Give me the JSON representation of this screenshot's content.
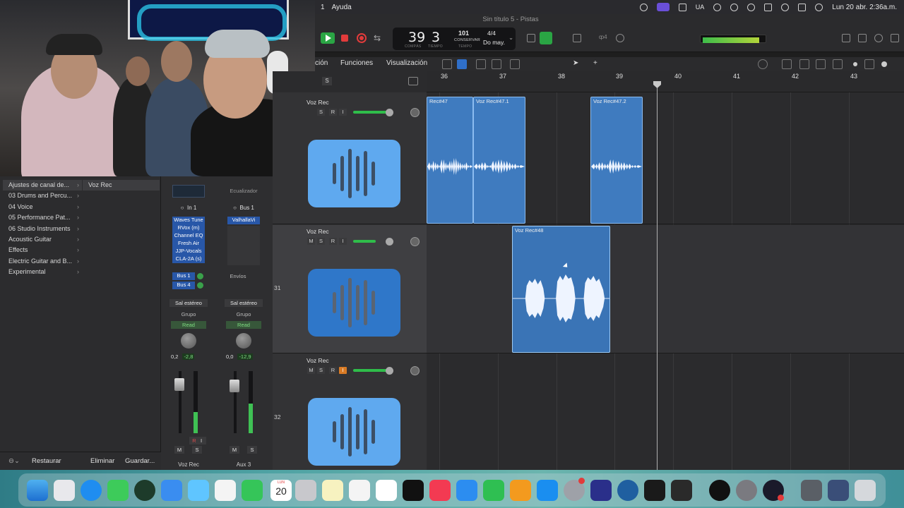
{
  "menubar": {
    "menu_num": "1",
    "menu_help": "Ayuda",
    "status_lang": "UA",
    "clock": "Lun 20 abr.  2:36a.m."
  },
  "window": {
    "title": "Sin título 5 - Pistas"
  },
  "transport": {
    "bar": "39",
    "beat": "3",
    "bar_label": "COMPÁS",
    "beat_label": "TIEMPO",
    "tempo": "101",
    "tempo_mode": "CONSERVAR",
    "tempo_label": "TEMPO",
    "time_sig": "4/4",
    "key": "Do may.",
    "count_in": "ȹ4"
  },
  "toolbar": {
    "menu_edit": "ción",
    "menu_functions": "Funciones",
    "menu_view": "Visualización"
  },
  "ruler": {
    "bars": [
      "36",
      "37",
      "38",
      "39",
      "40",
      "41",
      "42",
      "43"
    ]
  },
  "library": {
    "items": [
      "Ajustes de canal de...",
      "03 Drums and Percu...",
      "04 Voice",
      "05 Performance Pat...",
      "06 Studio Instruments",
      "Acoustic Guitar",
      "Effects",
      "Electric Guitar and B...",
      "Experimental"
    ],
    "selected_sub": "Voz Rec",
    "footer_restore": "Restaurar",
    "footer_delete": "Eliminar",
    "footer_save": "Guardar..."
  },
  "inspector": {
    "strip1": {
      "input": "In 1",
      "plugins": [
        "Waves Tune",
        "RVox (m)",
        "Channel EQ",
        "Fresh Air",
        "JJP-Vocals",
        "CLA-2A (s)"
      ],
      "sends": [
        "Bus 1",
        "Bus 4"
      ],
      "output": "Sal estéreo",
      "group": "Grupo",
      "automation": "Read",
      "pan_value": "0,2",
      "gain_value": "-2,8",
      "name": "Voz Rec",
      "mute": "M",
      "solo": "S",
      "rec": "R",
      "input_mon": "I"
    },
    "strip2": {
      "eq_label": "Ecualizador",
      "input": "Bus 1",
      "plugins": [
        "ValhallaVi"
      ],
      "sends_label": "Envíos",
      "output": "Sal estéreo",
      "group": "Grupo",
      "automation": "Read",
      "pan_value": "0,0",
      "gain_value": "-12,9",
      "name": "Aux 3",
      "mute": "M",
      "solo": "S"
    }
  },
  "tracks": [
    {
      "number": "",
      "name": "Voz Rec",
      "buttons": [
        "S",
        "R",
        "I"
      ],
      "regions": [
        {
          "name": "Rec#47"
        },
        {
          "name": "Voz Rec#47.1"
        },
        {
          "name": "Voz Rec#47.2"
        }
      ]
    },
    {
      "number": "31",
      "name": "Voz Rec",
      "buttons": [
        "M",
        "S",
        "R",
        "I"
      ],
      "regions": [
        {
          "name": "Voz Rec#48"
        }
      ]
    },
    {
      "number": "32",
      "name": "Voz Rec",
      "buttons": [
        "M",
        "S",
        "R",
        "I"
      ],
      "regions": []
    }
  ],
  "header_solo": "S",
  "dock": {
    "calendar_month": "LUN",
    "calendar_day": "20"
  }
}
